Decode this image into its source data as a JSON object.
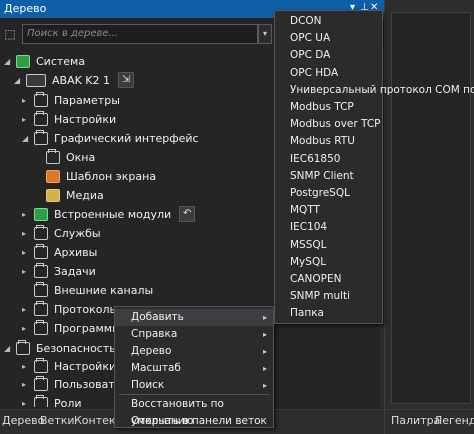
{
  "titlebar": {
    "title": "Дерево",
    "dropdown_glyph": "▾",
    "pin_glyph": "⊥",
    "close_glyph": "✕"
  },
  "search": {
    "placeholder": "Поиск в дереве...",
    "tool_icon": "tree-tool-icon",
    "dropdown_glyph": "▾"
  },
  "tree": {
    "nodes": [
      {
        "label": "Система",
        "icon": "system-icon",
        "expanded": true,
        "arrow": "◢"
      },
      {
        "label": "ABAK K2 1",
        "icon": "device-icon",
        "expanded": true,
        "arrow": "◢",
        "badge": "⇲"
      },
      {
        "label": "Параметры",
        "icon": "folder-icon",
        "arrow": "▸"
      },
      {
        "label": "Настройки",
        "icon": "folder-icon",
        "arrow": "▸"
      },
      {
        "label": "Графический интерфейс",
        "icon": "folder-icon",
        "expanded": true,
        "arrow": "◢"
      },
      {
        "label": "Окна",
        "icon": "folder-icon"
      },
      {
        "label": "Шаблон экрана",
        "icon": "screen-template-icon"
      },
      {
        "label": "Медиа",
        "icon": "media-icon"
      },
      {
        "label": "Встроенные модули",
        "icon": "module-icon",
        "arrow": "▸",
        "badge": "↶"
      },
      {
        "label": "Службы",
        "icon": "folder-icon",
        "arrow": "▸"
      },
      {
        "label": "Архивы",
        "icon": "folder-icon",
        "arrow": "▸"
      },
      {
        "label": "Задачи",
        "icon": "folder-icon",
        "arrow": "▸"
      },
      {
        "label": "Внешние каналы",
        "icon": "folder-icon"
      },
      {
        "label": "Протоколы",
        "icon": "folder-icon",
        "arrow": "▸"
      },
      {
        "label": "Программы",
        "icon": "folder-icon",
        "arrow": "▸"
      },
      {
        "label": "Безопасность",
        "icon": "folder-icon",
        "expanded": true,
        "arrow": "◢"
      },
      {
        "label": "Настройки",
        "icon": "folder-icon",
        "arrow": "▸"
      },
      {
        "label": "Пользовател",
        "icon": "folder-icon",
        "arrow": "▸"
      },
      {
        "label": "Роли",
        "icon": "folder-icon",
        "arrow": "▸"
      }
    ]
  },
  "bottom_tabs": [
    "Дерево",
    "Ветки",
    "Контекст"
  ],
  "right_tabs": [
    "Палитра",
    "Легенда"
  ],
  "context_menu": {
    "items": [
      {
        "label": "Добавить",
        "has_submenu": true,
        "active": true
      },
      {
        "label": "Справка",
        "has_submenu": true
      },
      {
        "label": "Дерево",
        "has_submenu": true
      },
      {
        "label": "Масштаб",
        "has_submenu": true
      },
      {
        "label": "Поиск",
        "has_submenu": true
      },
      {
        "label": "Восстановить по умолчанию",
        "has_submenu": false
      },
      {
        "label": "Открыть в панели веток",
        "has_submenu": false
      }
    ],
    "submenu_glyph": "▸"
  },
  "submenu": {
    "items": [
      "DCON",
      "OPC UA",
      "OPC DA",
      "OPC HDA",
      "Универсальный протокол COM порта",
      "Modbus TCP",
      "Modbus over TCP",
      "Modbus RTU",
      "IEC61850",
      "SNMP Client",
      "PostgreSQL",
      "MQTT",
      "IEC104",
      "MSSQL",
      "MySQL",
      "CANOPEN",
      "SNMP multi",
      "Папка"
    ]
  },
  "colors": {
    "titlebar": "#0e5ea8",
    "background": "#252526",
    "menu": "#2b2b2b"
  }
}
